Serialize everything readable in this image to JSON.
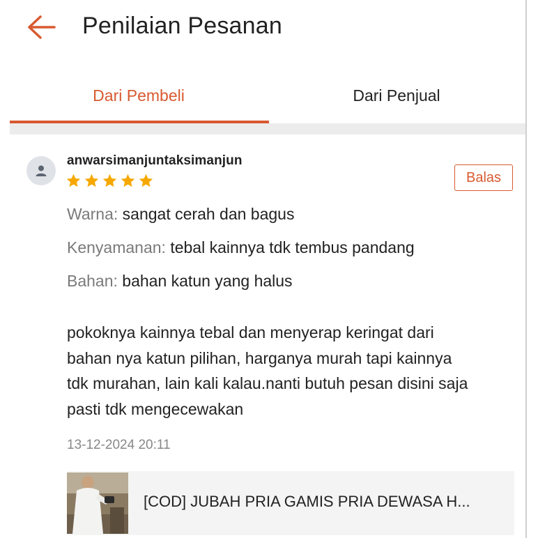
{
  "header": {
    "title": "Penilaian Pesanan",
    "back_icon": "arrow-left-icon"
  },
  "tabs": [
    {
      "label": "Dari Pembeli",
      "active": true
    },
    {
      "label": "Dari Penjual",
      "active": false
    }
  ],
  "review": {
    "username": "anwarsimanjuntaksimanjun",
    "avatar_icon": "user-icon",
    "rating": 5,
    "rating_max": 5,
    "reply_label": "Balas",
    "attributes": [
      {
        "label": "Warna:",
        "value": " sangat cerah dan bagus"
      },
      {
        "label": "Kenyamanan:",
        "value": " tebal kainnya tdk tembus pandang"
      },
      {
        "label": "Bahan:",
        "value": " bahan katun yang halus"
      }
    ],
    "comment_lines": [
      "pokoknya kainnya tebal dan menyerap keringat dari",
      "bahan nya katun pilihan, harganya murah tapi kainnya",
      "tdk murahan, lain kali kalau.nanti butuh pesan disini saja",
      "pasti tdk mengecewakan"
    ],
    "date": "13-12-2024 20:11"
  },
  "product": {
    "name": "[COD] JUBAH PRIA GAMIS PRIA DEWASA H..."
  },
  "colors": {
    "accent": "#d85a30",
    "star": "#f6a800",
    "muted_text": "#7a7a7a",
    "divider": "#ececec"
  }
}
